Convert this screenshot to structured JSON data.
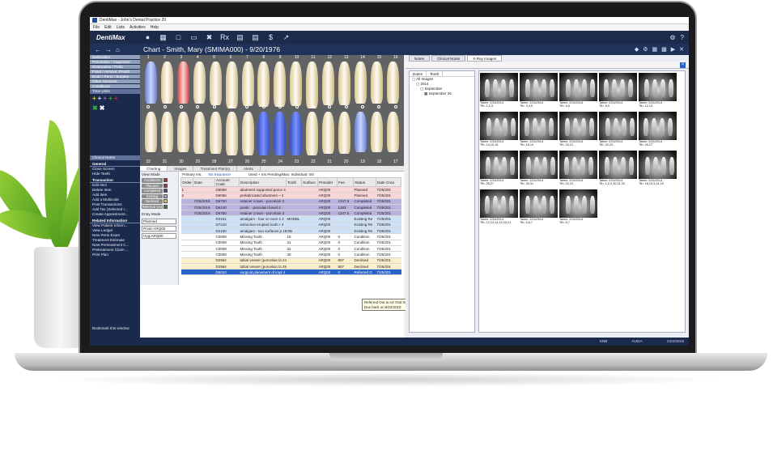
{
  "window": {
    "title": "DentiMax - John's Dental Practice 20"
  },
  "menu": [
    "File",
    "Edit",
    "Lists",
    "Activities",
    "Help"
  ],
  "toolbar": {
    "brand": "DentiMax",
    "icons": [
      "person-icon",
      "calendar-icon",
      "folder-icon",
      "folder-open-icon",
      "tooth-chart-icon",
      "rx-icon",
      "ledger-icon",
      "document-icon",
      "dollar-icon",
      "chart-icon"
    ],
    "rx_label": "Rx",
    "dollar_label": "$"
  },
  "header": {
    "chart_title": "Chart - Smith, Mary (SMIMA000) - 9/20/1976"
  },
  "sidebar": {
    "categories": [
      "Multicodes",
      "Preventive / Diagnostic",
      "Restorative / Pedo",
      "Fixed / remove. Prosth.",
      "Endo / Perio / Surgery",
      "Other Services",
      "Conditions",
      "Time Units"
    ],
    "clinical_notes": "Clinical Notes",
    "general_head": "General",
    "general": [
      "Close Screen",
      "Hide Teeth"
    ],
    "transaction_head": "Transaction",
    "transaction": [
      "Edit Item",
      "Delete Item",
      "Add Item",
      "Add a Multicode",
      "Post Transactions",
      "Add Tax (Selected I...",
      "Create Appointment..."
    ],
    "related_head": "Related Information",
    "related": [
      "View Patient Inform...",
      "View Ledger",
      "New Perio Exam",
      "Treatment Estimate",
      "New Pretreatment C...",
      "Pretreatment Claim ...",
      "Print Plan"
    ],
    "bookmark": "Bookmark this window"
  },
  "teeth": {
    "upper_numbers": [
      "1",
      "2",
      "3",
      "4",
      "5",
      "6",
      "7",
      "8",
      "9",
      "10",
      "11",
      "12",
      "13",
      "14",
      "15",
      "16"
    ],
    "lower_numbers": [
      "32",
      "31",
      "30",
      "29",
      "28",
      "27",
      "26",
      "25",
      "24",
      "23",
      "22",
      "21",
      "20",
      "19",
      "18",
      "17"
    ]
  },
  "chart_tabs": [
    "Charting",
    "Images",
    "Treatment Plan(s)",
    "Alerts"
  ],
  "view_mode": {
    "label": "View Mode",
    "buttons": [
      {
        "label": "Conditions",
        "color": "#c0282d"
      },
      {
        "label": "Planned",
        "color": "#c0282d"
      },
      {
        "label": "Completed",
        "color": "#4a3fb0"
      },
      {
        "label": "Existing",
        "color": "#8fb0e0"
      },
      {
        "label": "Declined",
        "color": "#e3c34a"
      },
      {
        "label": "Referred Out",
        "color": "#2d8a3a"
      }
    ],
    "entry_mode_label": "Entry Mode",
    "entry_mode_value": "Planned",
    "provider_label": "Prvdr:",
    "provider_value": "ARQ00",
    "hyg_label": "Hyg:",
    "hyg_value": "ARQ00"
  },
  "insurance": {
    "primary_label": "Primary Ins:",
    "primary_value": "No Insurance",
    "used_label": "Used + Ins Pending/Max: Individual: 0/0"
  },
  "table": {
    "headers": [
      "Order",
      "Date",
      "Account Code",
      "Description",
      "Tooth",
      "Surface",
      "Provider",
      "Fee",
      "Status",
      "Date Crea"
    ],
    "rows": [
      {
        "cls": "r-planned",
        "c": [
          "1",
          "",
          "D6059",
          "abutment supported porce 4",
          "",
          "",
          "ARQ00",
          "",
          "Planned",
          "7/25/201"
        ]
      },
      {
        "cls": "r-planned",
        "c": [
          "2",
          "",
          "D6056",
          "prefabricated abutment ~ 4",
          "",
          "",
          "ARQ00",
          "",
          "Planned",
          "7/25/201"
        ]
      },
      {
        "cls": "r-completed",
        "c": [
          "",
          "7/25/2019",
          "D6750",
          "retainer crown - porcelain 3",
          "",
          "",
          "ARQ00",
          "1347.5",
          "Completed",
          "7/25/201"
        ]
      },
      {
        "cls": "r-completed",
        "c": [
          "",
          "7/25/2019",
          "D6240",
          "pontic - porcelain fused 2",
          "",
          "",
          "ARQ00",
          "1383",
          "Completed",
          "7/25/201"
        ]
      },
      {
        "cls": "r-completed",
        "c": [
          "",
          "7/25/2019",
          "D6750",
          "retainer crown - porcelain 3",
          "",
          "",
          "ARQ00",
          "1347.5",
          "Completed",
          "7/25/201"
        ]
      },
      {
        "cls": "r-existing",
        "c": [
          "",
          "",
          "D2161",
          "amalgam - four or more s 2",
          "MODBL",
          "",
          "ARQ00",
          "",
          "Existing Re",
          "7/25/201"
        ]
      },
      {
        "cls": "r-existing",
        "c": [
          "",
          "",
          "D7210",
          "extraction erupted tooth r 4",
          "",
          "",
          "ARQ00",
          "",
          "Existing Re",
          "7/25/201"
        ]
      },
      {
        "cls": "r-existing",
        "c": [
          "",
          "",
          "D2150",
          "amalgam - two surfaces p 18",
          "OB",
          "",
          "ARQ00",
          "",
          "Existing Re",
          "7/25/201"
        ]
      },
      {
        "cls": "r-condition",
        "c": [
          "",
          "",
          "C0008",
          "Missing Tooth",
          "15",
          "",
          "ARQ00",
          "0",
          "Condition",
          "7/25/201"
        ]
      },
      {
        "cls": "r-condition",
        "c": [
          "",
          "",
          "C0008",
          "Missing Tooth",
          "31",
          "",
          "ARQ00",
          "0",
          "Condition",
          "7/25/201"
        ]
      },
      {
        "cls": "r-condition",
        "c": [
          "",
          "",
          "C0008",
          "Missing Tooth",
          "32",
          "",
          "ARQ00",
          "0",
          "Condition",
          "7/25/201"
        ]
      },
      {
        "cls": "r-condition",
        "c": [
          "",
          "",
          "C0008",
          "Missing Tooth",
          "30",
          "",
          "ARQ00",
          "0",
          "Condition",
          "7/25/201"
        ]
      },
      {
        "cls": "r-declined",
        "c": [
          "",
          "",
          "D2962",
          "labial veneer (porcelain la 24",
          "",
          "",
          "ARQ00",
          "807",
          "Declined",
          "7/25/201"
        ]
      },
      {
        "cls": "r-declined",
        "c": [
          "",
          "",
          "D2962",
          "labial veneer (porcelain la 25",
          "",
          "",
          "ARQ00",
          "807",
          "Declined",
          "7/25/201"
        ]
      },
      {
        "cls": "r-selected",
        "c": [
          "",
          "",
          "D6010",
          "surgical placement of impl 4",
          "",
          "",
          "ARQ00",
          "0",
          "Referred O",
          "7/25/201"
        ]
      }
    ]
  },
  "tooltip": {
    "line1": "Referred Out to AZ Oral Surgery Center",
    "line2": "Due back on 8/22/2019"
  },
  "right_tabs": [
    "Notes",
    "Clinical Notes",
    "X-Ray Images"
  ],
  "tree": {
    "tabs": [
      "Dates",
      "Teeth"
    ],
    "nodes": [
      "All Images",
      "2014",
      "September",
      "September 26"
    ]
  },
  "thumbnails": [
    {
      "taken": "Taken: 2/24/2014",
      "teeth": "Tth: 1,2,3"
    },
    {
      "taken": "Taken: 2/24/2014",
      "teeth": "Tth: 3,4,5"
    },
    {
      "taken": "Taken: 2/24/2014",
      "teeth": "Tth: 5,6"
    },
    {
      "taken": "Taken: 2/24/2014",
      "teeth": "Tth: 8,9"
    },
    {
      "taken": "Taken: 2/24/2014",
      "teeth": "Tth: 12,13"
    },
    {
      "taken": "Taken: 2/24/2014",
      "teeth": "Tth: 14,15,16"
    },
    {
      "taken": "Taken: 2/24/2014",
      "teeth": "Tth: 18,19"
    },
    {
      "taken": "Taken: 2/24/2014",
      "teeth": "Tth: 20,21"
    },
    {
      "taken": "Taken: 2/24/2014",
      "teeth": "Tth: 22,23"
    },
    {
      "taken": "Taken: 2/24/2014",
      "teeth": "Tth: 26,27"
    },
    {
      "taken": "Taken: 2/24/2014",
      "teeth": "Tth: 28,27"
    },
    {
      "taken": "Taken: 2/24/2014",
      "teeth": "Tth: 30,31"
    },
    {
      "taken": "Taken: 2/24/2014",
      "teeth": "Tth: 22,23"
    },
    {
      "taken": "Taken: 2/24/2014",
      "teeth": "Tth: 1,2,3,30,31,32"
    },
    {
      "taken": "Taken: 2/24/2014",
      "teeth": "Tth: 18,19,3,14,15"
    },
    {
      "taken": "Taken: 2/24/2014",
      "teeth": "Tth: 12,13,14,15,20,21"
    },
    {
      "taken": "Taken: 2/24/2014",
      "teeth": "Tth: 5,6,7"
    },
    {
      "taken": "Taken: 2/24/2014",
      "teeth": "Tth: 6,7"
    }
  ],
  "status": {
    "left": "",
    "server": "SNB",
    "user": "AUDA",
    "date": "10/2/2019"
  }
}
